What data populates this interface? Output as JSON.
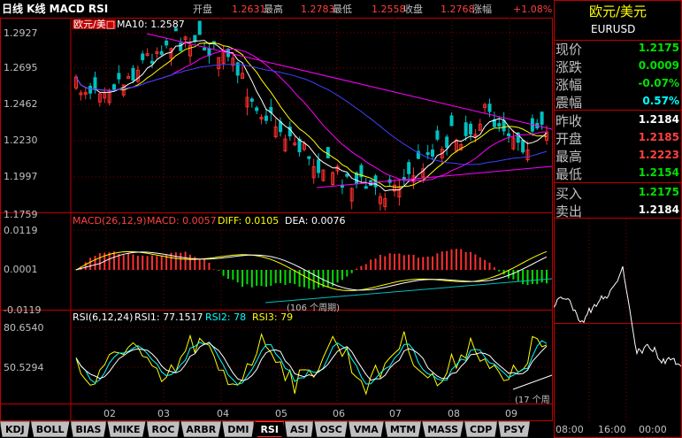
{
  "window_title": "日线 K线 MACD RSI",
  "topbar": [
    {
      "label": "开盘",
      "value": "1.2631"
    },
    {
      "label": "最高",
      "value": "1.2783"
    },
    {
      "label": "最低",
      "value": "1.2558"
    },
    {
      "label": "收盘",
      "value": "1.2768"
    },
    {
      "label": "涨幅",
      "value": "+1.08%"
    }
  ],
  "kline": {
    "symbol_label": "欧元/美□",
    "ma_label": "MA10: 1.2587",
    "y_ticks": [
      "1.2927",
      "1.2695",
      "1.2462",
      "1.2230",
      "1.1997",
      "1.1759"
    ]
  },
  "macd": {
    "title": "MACD(26,12,9)",
    "macd_value": "MACD: 0.0057",
    "diff": "DIFF: 0.0105",
    "dea": "DEA: 0.0076",
    "y_ticks": [
      "0.0119",
      "0.0001",
      "-0.0119"
    ],
    "annotation": "(106 个周期)"
  },
  "rsi": {
    "title": "RSI(6,12,24)",
    "rsi1": "RSI1: 77.1517",
    "rsi2": "RSI2: 78",
    "rsi3": "RSI3: 79",
    "y_ticks": [
      "80.6540",
      "50.5294"
    ],
    "annotation": "(17 个周"
  },
  "x_ticks": [
    "02",
    "03",
    "04",
    "05",
    "06",
    "07",
    "08",
    "09"
  ],
  "tabs": [
    "KDJ",
    "BOLL",
    "BIAS",
    "MIKE",
    "ROC",
    "ARBR",
    "DMI",
    "RSI",
    "ASI",
    "OSC",
    "VMA",
    "MTM",
    "MASS",
    "CDP",
    "PSY"
  ],
  "active_tab": "RSI",
  "quote": {
    "name": "欧元/美元",
    "code": "EURUSD",
    "rows": [
      {
        "label": "现价",
        "value": "1.2175",
        "color": "#00e000"
      },
      {
        "label": "涨跌",
        "value": "0.0009",
        "color": "#00e000"
      },
      {
        "label": "涨幅",
        "value": "-0.07%",
        "color": "#00e000"
      },
      {
        "label": "震幅",
        "value": "0.57%",
        "color": "#00ffff"
      },
      {
        "label": "昨收",
        "value": "1.2184",
        "color": "#ffffff"
      },
      {
        "label": "开盘",
        "value": "1.2185",
        "color": "#ff4040"
      },
      {
        "label": "最高",
        "value": "1.2223",
        "color": "#ff4040"
      },
      {
        "label": "最低",
        "value": "1.2154",
        "color": "#00e000"
      },
      {
        "label": "买入",
        "value": "1.2175",
        "color": "#00e000"
      },
      {
        "label": "卖出",
        "value": "1.2184",
        "color": "#ffffff"
      }
    ],
    "time_ticks": [
      "08:00",
      "16:00",
      "00:00"
    ]
  },
  "colors": {
    "up": "#ff3030",
    "down": "#00c0c0",
    "ma_white": "#ffffff",
    "ma_yellow": "#ffff00",
    "ma_magenta": "#ff00ff",
    "ma_blue": "#4040ff"
  }
}
